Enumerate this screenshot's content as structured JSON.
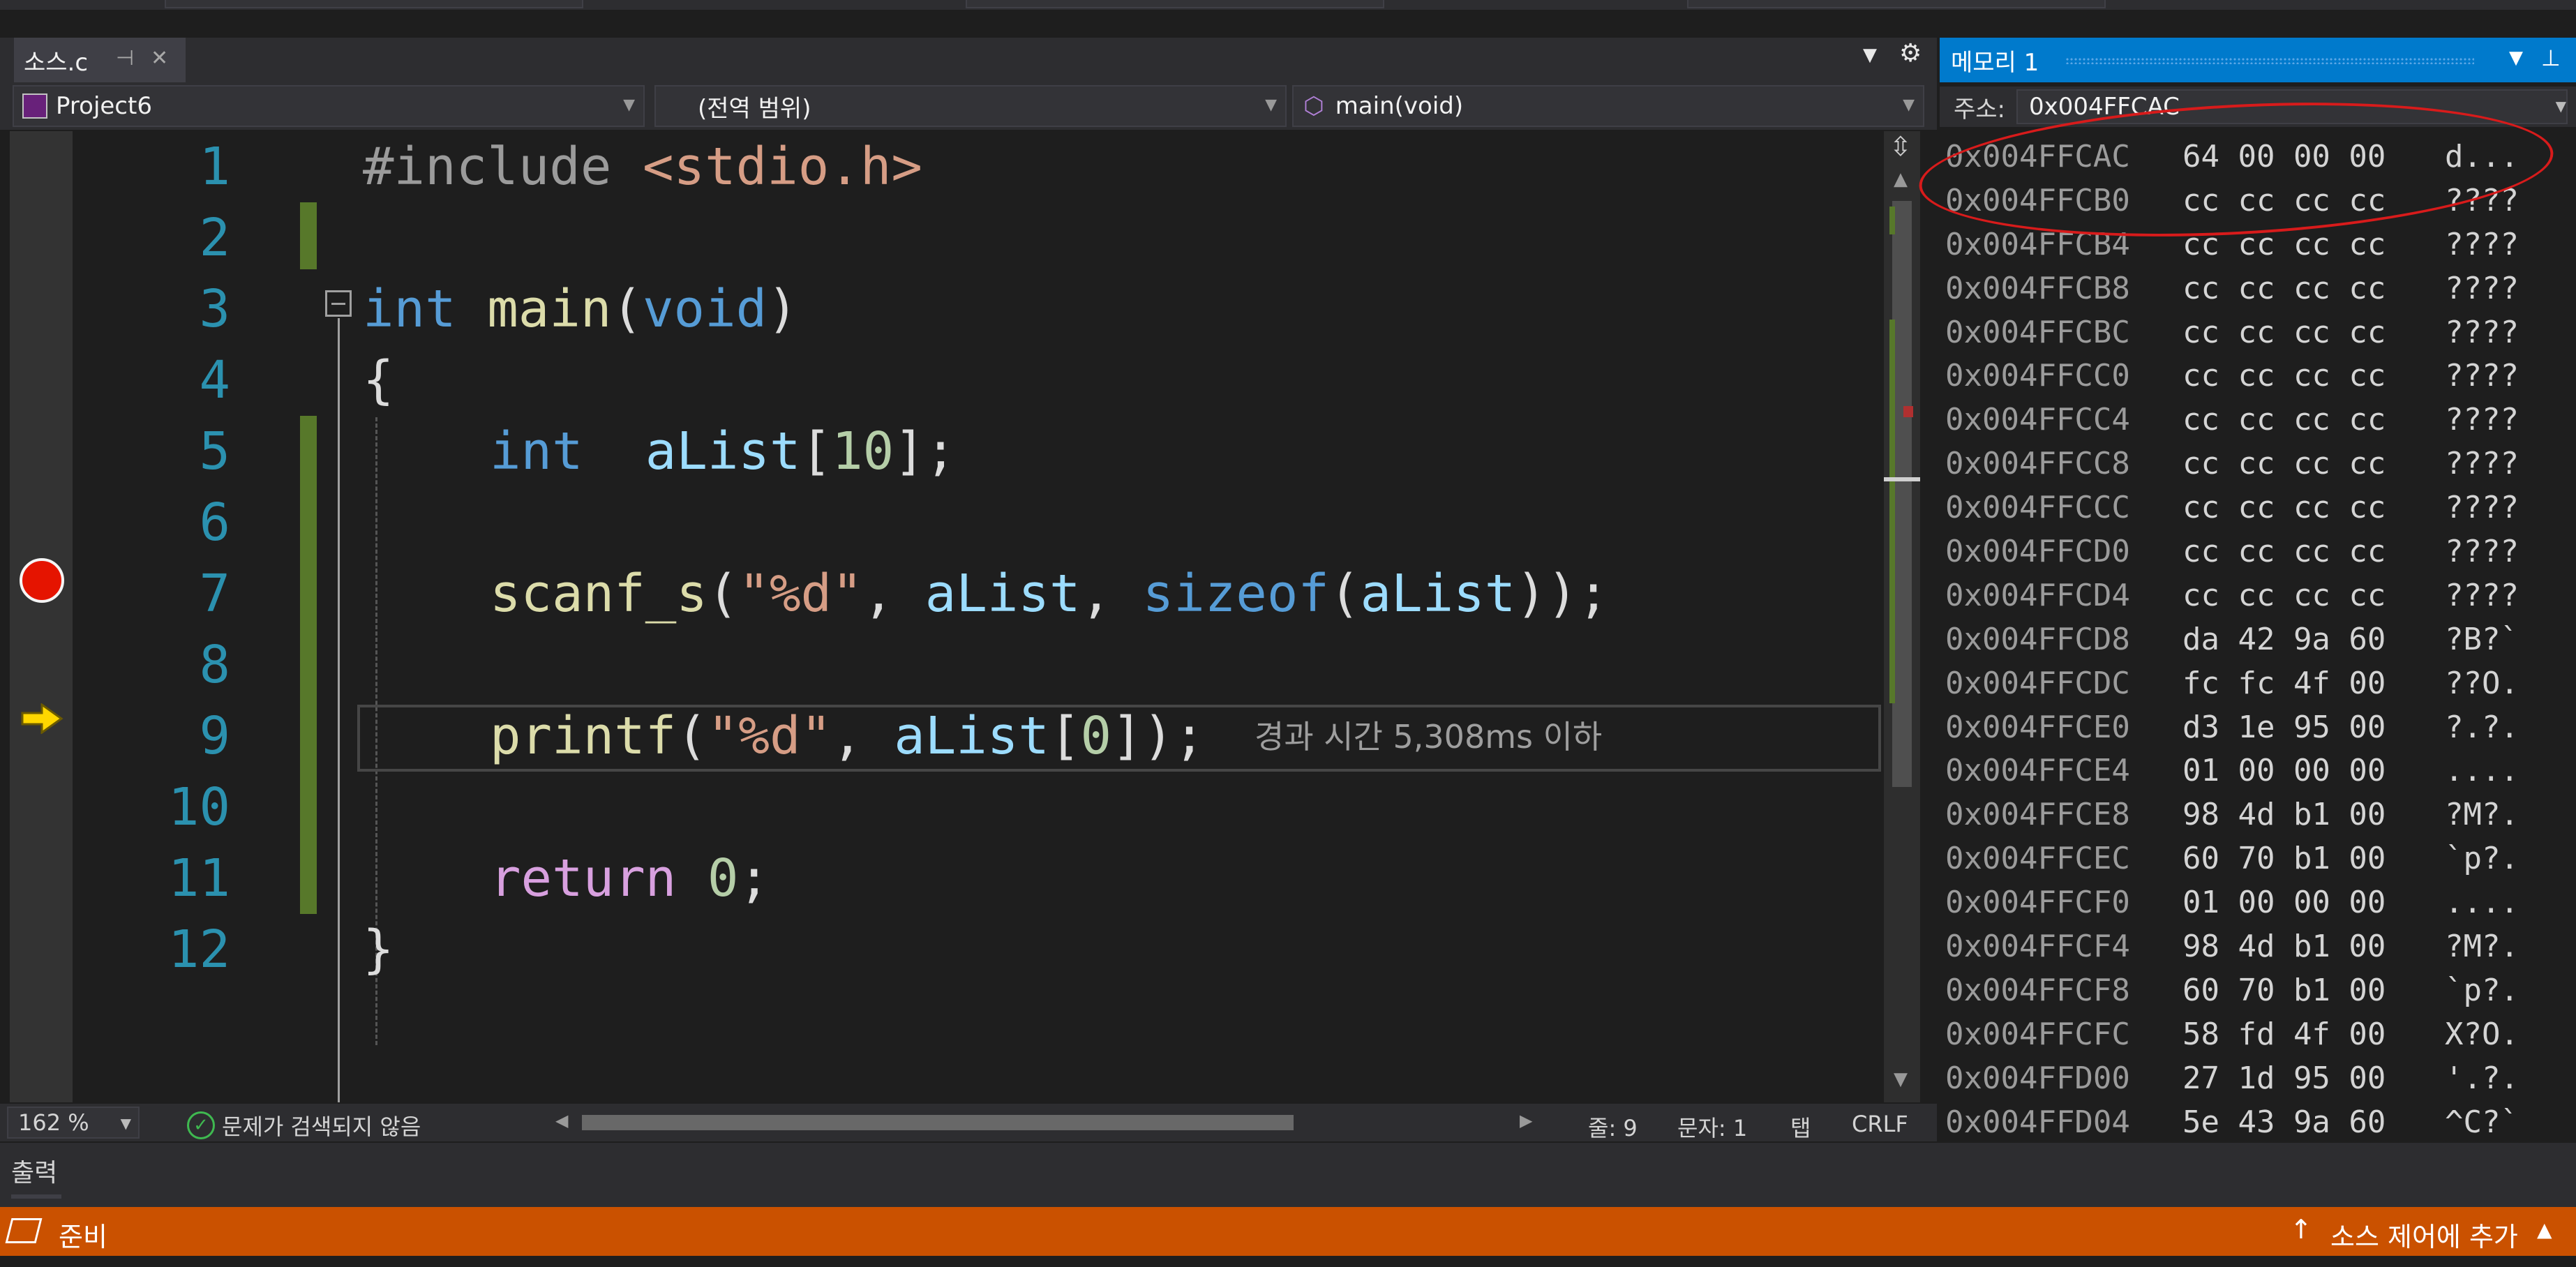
{
  "editor_tab": {
    "title": "소스.c"
  },
  "nav": {
    "project": "Project6",
    "scope": "(전역 범위)",
    "function": "main(void)"
  },
  "code": {
    "line_numbers": [
      "1",
      "2",
      "3",
      "4",
      "5",
      "6",
      "7",
      "8",
      "9",
      "10",
      "11",
      "12"
    ],
    "l1": {
      "directive": "#include",
      "header": "<stdio.h>"
    },
    "l3": {
      "type": "int",
      "name": "main",
      "open": "(",
      "param": "void",
      "close": ")"
    },
    "l4": "{",
    "l5": {
      "type": "int",
      "name": "aList",
      "open": "[",
      "size": "10",
      "close": "];"
    },
    "l7": {
      "fn": "scanf_s",
      "open": "(",
      "fmt": "\"%d\"",
      "sep1": ", ",
      "arg": "aList",
      "sep2": ", ",
      "sizeof": "sizeof",
      "p1": "(",
      "arg2": "aList",
      "end": "));"
    },
    "l9": {
      "fn": "printf",
      "open": "(",
      "fmt": "\"%d\"",
      "sep": ", ",
      "arg": "aList",
      "b1": "[",
      "idx": "0",
      "b2": "]",
      "end": ");"
    },
    "l11": {
      "kw": "return",
      "val": "0",
      "end": ";"
    },
    "l12": "}",
    "elapsed_hint": "경과 시간 5,308ms 이하"
  },
  "editor_status": {
    "zoom": "162 %",
    "issues": "문제가 검색되지 않음",
    "line": "줄: 9",
    "char": "문자: 1",
    "indent": "탭",
    "eol": "CRLF"
  },
  "memory": {
    "title": "메모리 1",
    "address_label": "주소:",
    "address_value": "0x004FFCAC",
    "rows": [
      [
        "0x004FFCAC",
        "64 00 00 00",
        "d..."
      ],
      [
        "0x004FFCB0",
        "cc cc cc cc",
        "????"
      ],
      [
        "0x004FFCB4",
        "cc cc cc cc",
        "????"
      ],
      [
        "0x004FFCB8",
        "cc cc cc cc",
        "????"
      ],
      [
        "0x004FFCBC",
        "cc cc cc cc",
        "????"
      ],
      [
        "0x004FFCC0",
        "cc cc cc cc",
        "????"
      ],
      [
        "0x004FFCC4",
        "cc cc cc cc",
        "????"
      ],
      [
        "0x004FFCC8",
        "cc cc cc cc",
        "????"
      ],
      [
        "0x004FFCCC",
        "cc cc cc cc",
        "????"
      ],
      [
        "0x004FFCD0",
        "cc cc cc cc",
        "????"
      ],
      [
        "0x004FFCD4",
        "cc cc cc cc",
        "????"
      ],
      [
        "0x004FFCD8",
        "da 42 9a 60",
        "?B?`"
      ],
      [
        "0x004FFCDC",
        "fc fc 4f 00",
        "??O."
      ],
      [
        "0x004FFCE0",
        "d3 1e 95 00",
        "?.?."
      ],
      [
        "0x004FFCE4",
        "01 00 00 00",
        "...."
      ],
      [
        "0x004FFCE8",
        "98 4d b1 00",
        "?M?."
      ],
      [
        "0x004FFCEC",
        "60 70 b1 00",
        "`p?."
      ],
      [
        "0x004FFCF0",
        "01 00 00 00",
        "...."
      ],
      [
        "0x004FFCF4",
        "98 4d b1 00",
        "?M?."
      ],
      [
        "0x004FFCF8",
        "60 70 b1 00",
        "`p?."
      ],
      [
        "0x004FFCFC",
        "58 fd 4f 00",
        "X?O."
      ],
      [
        "0x004FFD00",
        "27 1d 95 00",
        "'.?."
      ],
      [
        "0x004FFD04",
        "5e 43 9a 60",
        "^C?`"
      ]
    ]
  },
  "output_panel": {
    "label": "출력"
  },
  "statusbar": {
    "ready": "준비",
    "source_control": "소스 제어에 추가",
    "color": "#ca5100"
  },
  "icons": {
    "breakpoint": "breakpoint-icon",
    "execution": "current-statement-arrow-icon",
    "settings": "gear-icon",
    "pin": "pin-icon",
    "close": "close-icon",
    "ok": "check-circle-icon"
  }
}
